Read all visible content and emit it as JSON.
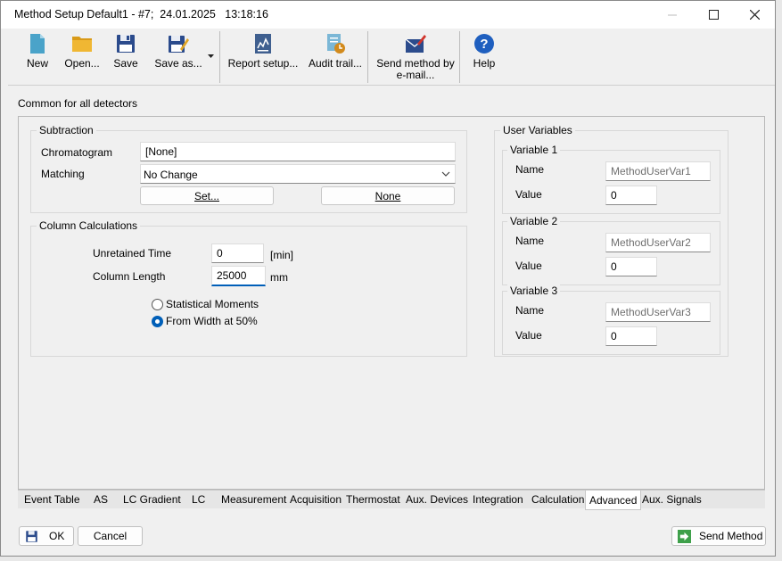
{
  "window": {
    "title": "Method Setup Default1 - #7;  24.01.2025   13:18:16"
  },
  "toolbar": {
    "new_label": "New",
    "open_label": "Open...",
    "save_label": "Save",
    "save_as_label": "Save as...",
    "report_setup_label": "Report setup...",
    "audit_trail_label": "Audit trail...",
    "send_method_label": "Send method by\ne-mail...",
    "help_label": "Help"
  },
  "header": {
    "section_label": "Common for all detectors"
  },
  "subtraction": {
    "title": "Subtraction",
    "chromatogram_label": "Chromatogram",
    "chromatogram_value": "[None]",
    "matching_label": "Matching",
    "matching_value": "No Change",
    "set_button": "Set...",
    "none_button": "None"
  },
  "column_calc": {
    "title": "Column Calculations",
    "unretained_label": "Unretained Time",
    "unretained_value": "0",
    "unretained_unit": "[min]",
    "length_label": "Column Length",
    "length_value": "25000",
    "length_unit": "mm",
    "radio_moments": "Statistical Moments",
    "radio_width": "From Width at 50%",
    "selected": "width"
  },
  "user_variables": {
    "title": "User Variables",
    "name_label": "Name",
    "value_label": "Value",
    "vars": [
      {
        "title": "Variable 1",
        "name": "MethodUserVar1",
        "value": "0"
      },
      {
        "title": "Variable 2",
        "name": "MethodUserVar2",
        "value": "0"
      },
      {
        "title": "Variable 3",
        "name": "MethodUserVar3",
        "value": "0"
      }
    ]
  },
  "tabs": [
    "Event Table",
    "AS",
    "LC Gradient",
    "LC",
    "Measurement",
    "Acquisition",
    "Thermostat",
    "Aux. Devices",
    "Integration",
    "Calculation",
    "Advanced",
    "Aux. Signals"
  ],
  "active_tab": "Advanced",
  "footer": {
    "ok_label": "OK",
    "cancel_label": "Cancel",
    "send_method_label": "Send Method"
  },
  "colors": {
    "accent": "#005fb8",
    "new_icon": "#4aa3c9",
    "open_icon": "#e0a526",
    "save_icon": "#2b4b8c",
    "help_icon": "#1f5fbf",
    "send_icon": "#3ea04a"
  }
}
